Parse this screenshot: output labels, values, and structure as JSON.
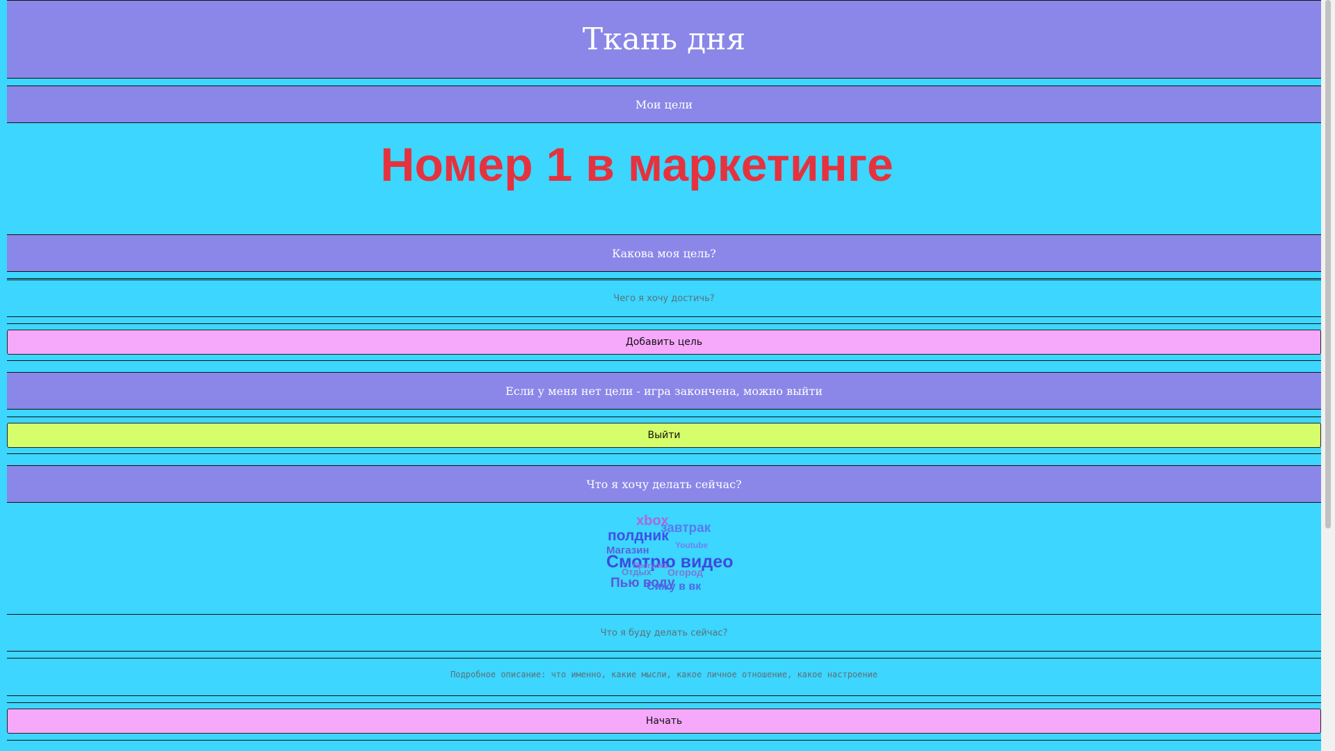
{
  "header": {
    "title": "Ткань дня"
  },
  "goals_bar": {
    "label": "Мои цели"
  },
  "current_goal": {
    "text": "Номер 1 в маркетинге"
  },
  "goal_question": {
    "label": "Какова моя цель?"
  },
  "goal_input": {
    "placeholder": "Чего я хочу достичь?",
    "value": ""
  },
  "add_goal_button": {
    "label": "Добавить цель"
  },
  "no_goal_bar": {
    "label": "Если у меня нет цели - игра закончена, можно выйти"
  },
  "exit_button": {
    "label": "Выйти"
  },
  "now_question": {
    "label": "Что я хочу делать сейчас?"
  },
  "word_cloud": {
    "words": [
      {
        "text": "xbox",
        "color": "#b266d6"
      },
      {
        "text": "завтрак",
        "color": "#5a79ee"
      },
      {
        "text": "полдник",
        "color": "#3f4fe6"
      },
      {
        "text": "Youtube",
        "color": "#6f82f2"
      },
      {
        "text": "Магазин",
        "color": "#5a62d8"
      },
      {
        "text": "Смотрю видео",
        "color": "#3f48e0"
      },
      {
        "text": "Отдых",
        "color": "#6f7ecf"
      },
      {
        "text": "Огород",
        "color": "#7e78d3"
      },
      {
        "text": "Пью воду",
        "color": "#5a5ad6"
      },
      {
        "text": "Сижу в вк",
        "color": "#4d68e8"
      },
      {
        "text": "Прогулка",
        "color": "#8b6fd9"
      }
    ]
  },
  "now_input": {
    "placeholder": "Что я буду делать сейчас?",
    "value": ""
  },
  "details_input": {
    "placeholder": "Подробное описание: что именно, какие мысли, какое личное отношение, какое настроение",
    "value": ""
  },
  "start_button": {
    "label": "Начать"
  },
  "colors": {
    "page_bg": "#3cd6fe",
    "band_bg": "#8a87e8",
    "goal_text": "#e4333f",
    "pink_button": "#f6a8fb",
    "lime_button": "#d6fe6a"
  }
}
